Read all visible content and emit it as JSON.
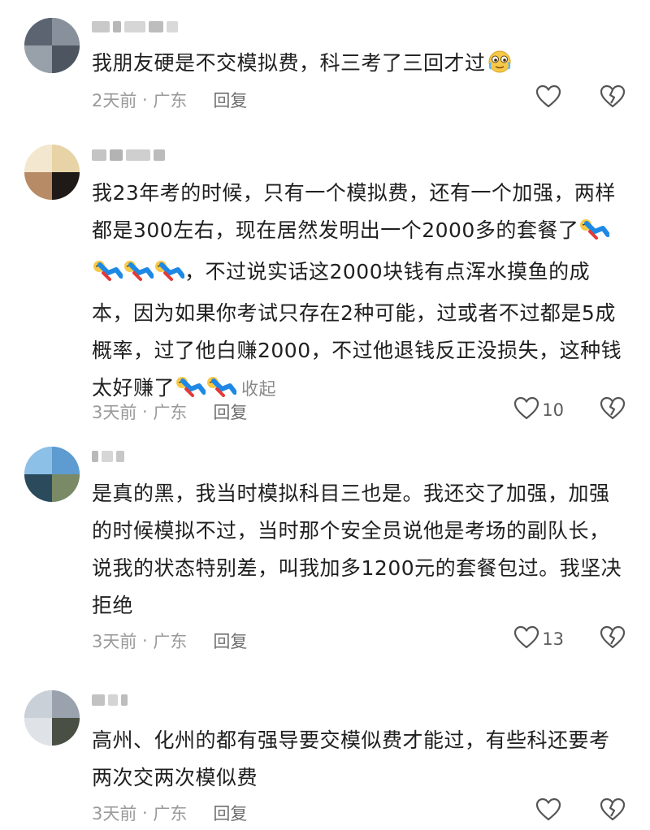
{
  "comments": [
    {
      "text": "我朋友硬是不交模拟费，科三考了三回才过",
      "time": "2天前",
      "sep": " · ",
      "location": "广东",
      "reply": "回复",
      "likes": "",
      "emoji_icons": [
        "crying-smile-emoji-icon"
      ]
    },
    {
      "text_part1": "我23年考的时候，只有一个模拟费，还有一个加强，两样都是300左右，现在居然发明出一个2000多的套餐了",
      "text_part2": "，不过说实话这2000块钱有点浑水摸鱼的成本，因为如果你考试只存在2种可能，过或者不过都是5成概率，过了他白赚2000，不过他退钱反正没损失，这种钱太好赚了",
      "collapse": "收起",
      "time": "3天前",
      "sep": " · ",
      "location": "广东",
      "reply": "回复",
      "likes": "10",
      "emoji_icons": [
        "lying-flat-emoji-icon"
      ]
    },
    {
      "text": "是真的黑，我当时模拟科目三也是。我还交了加强，加强的时候模拟不过，当时那个安全员说他是考场的副队长，说我的状态特别差，叫我加多1200元的套餐包过。我坚决拒绝",
      "time": "3天前",
      "sep": " · ",
      "location": "广东",
      "reply": "回复",
      "likes": "13"
    },
    {
      "text": "高州、化州的都有强导要交模似费才能过，有些科还要考两次交两次模似费",
      "time": "3天前",
      "sep": " · ",
      "location": "广东",
      "reply": "回复",
      "likes": ""
    }
  ],
  "colors": {
    "text": "#1f1f1f",
    "meta": "#9a9a9a",
    "reply": "#6f6f6f",
    "icon": "#555555"
  }
}
